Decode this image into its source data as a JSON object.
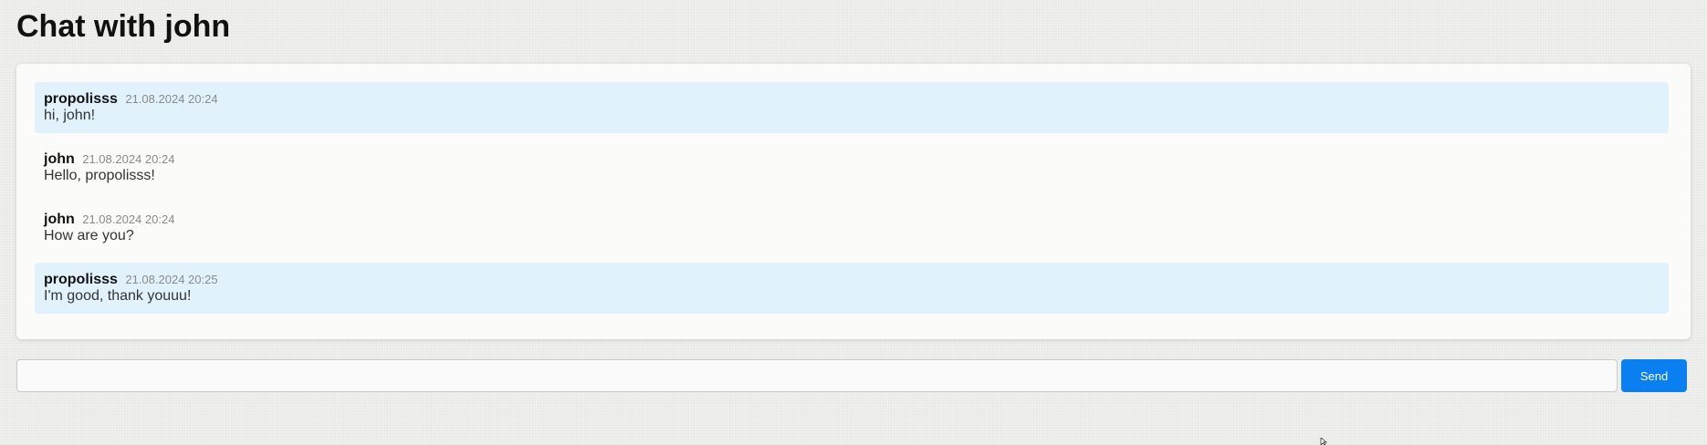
{
  "page": {
    "title": "Chat with john"
  },
  "messages": [
    {
      "author": "propolisss",
      "time": "21.08.2024 20:24",
      "text": "hi, john!",
      "own": true
    },
    {
      "author": "john",
      "time": "21.08.2024 20:24",
      "text": "Hello, propolisss!",
      "own": false
    },
    {
      "author": "john",
      "time": "21.08.2024 20:24",
      "text": "How are you?",
      "own": false
    },
    {
      "author": "propolisss",
      "time": "21.08.2024 20:25",
      "text": "I'm good, thank youuu!",
      "own": true
    }
  ],
  "composer": {
    "value": "",
    "placeholder": "",
    "send_label": "Send"
  },
  "colors": {
    "own_message_bg": "#e1f2fc",
    "send_button_bg": "#0a7ff0"
  },
  "icons": {
    "cursor": "mouse-pointer-icon"
  }
}
